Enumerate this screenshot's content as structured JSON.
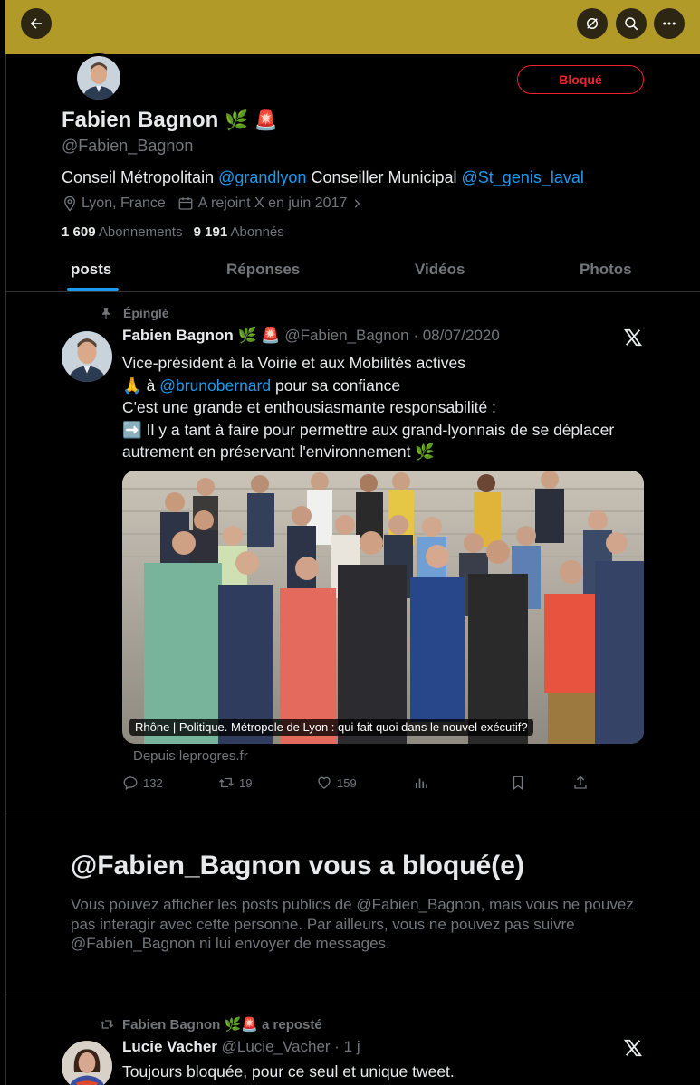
{
  "profile": {
    "name": "Fabien Bagnon",
    "emoji1": "🌿",
    "emoji2": "🚨",
    "handle": "@Fabien_Bagnon",
    "bio_part1": "Conseil Métropolitain ",
    "bio_link1": "@grandlyon",
    "bio_part2": " Conseiller Municipal ",
    "bio_link2": "@St_genis_laval",
    "location": "Lyon, France",
    "joined": "A rejoint X en juin 2017",
    "following_count": "1 609",
    "following_label": "Abonnements",
    "followers_count": "9 191",
    "followers_label": "Abonnés",
    "blocked_button": "Bloqué"
  },
  "tabs": [
    "posts",
    "Réponses",
    "Vidéos",
    "Photos"
  ],
  "pinned_post": {
    "pinned_label": "Épinglé",
    "author": "Fabien Bagnon",
    "emojis": "🌿 🚨",
    "handle_date": "@Fabien_Bagnon · 08/07/2020",
    "line1": "Vice-président à la Voirie et aux Mobilités actives",
    "line2_pre": "🙏 à ",
    "line2_link": "@brunobernard",
    "line2_post": " pour sa confiance",
    "line3": "C'est une grande et enthousiasmante responsabilité :",
    "line4": "➡️ Il y a tant à faire pour permettre aux grand-lyonnais de se déplacer autrement en préservant l'environnement 🌿",
    "card_caption": "Rhône | Politique. Métropole de Lyon : qui fait quoi dans le nouvel exécutif?",
    "card_source": "Depuis leprogres.fr",
    "replies": "132",
    "reposts": "19",
    "likes": "159"
  },
  "block_notice": {
    "title": "@Fabien_Bagnon vous a bloqué(e)",
    "text": "Vous pouvez afficher les posts publics de @Fabien_Bagnon, mais vous ne pouvez pas interagir avec cette personne. Par ailleurs, vous ne pouvez pas suivre @Fabien_Bagnon ni lui envoyer de messages."
  },
  "repost": {
    "reposter": "Fabien Bagnon 🌿🚨 a reposté",
    "author": "Lucie Vacher",
    "handle_time": "@Lucie_Vacher · 1 j",
    "text": "Toujours bloquée, pour ce seul et unique tweet."
  },
  "colors": {
    "banner": "#b19a27",
    "accent": "#1d9bf0",
    "blocked": "#f4212e",
    "muted": "#71767b"
  },
  "icons": [
    "back-arrow-icon",
    "grok-icon",
    "search-icon",
    "more-icon",
    "location-icon",
    "calendar-icon",
    "chevron-right-icon",
    "pin-icon",
    "x-logo-icon",
    "reply-icon",
    "repost-icon",
    "like-icon",
    "views-icon",
    "bookmark-icon",
    "share-icon"
  ]
}
